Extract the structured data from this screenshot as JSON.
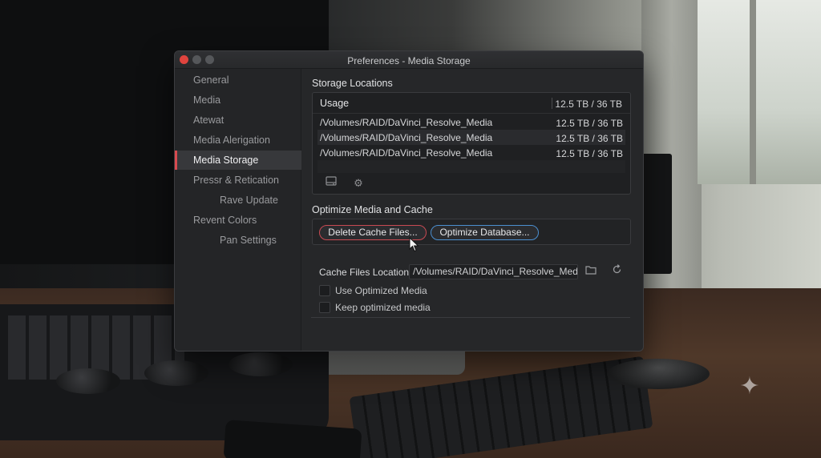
{
  "window": {
    "title": "Preferences - Media Storage"
  },
  "sidebar": {
    "items": [
      {
        "label": "General"
      },
      {
        "label": "Media"
      },
      {
        "label": "Atewat"
      },
      {
        "label": "Media Alerigation"
      },
      {
        "label": "Media Storage",
        "active": true
      },
      {
        "label": "Pressr & Retication"
      },
      {
        "label": "Rave Update",
        "sub": true
      },
      {
        "label": "Revent Colors"
      },
      {
        "label": "Pan Settings",
        "sub": true
      }
    ]
  },
  "storage": {
    "section_title": "Storage Locations",
    "header_label": "Usage",
    "header_value": "12.5 TB / 36 TB",
    "rows": [
      {
        "path": "/Volumes/RAID/DaVinci_Resolve_Media",
        "size": "12.5 TB / 36 TB"
      },
      {
        "path": "/Volumes/RAID/DaVinci_Resolve_Media",
        "size": "12.5 TB / 36 TB"
      },
      {
        "path": "/Volumes/RAID/DaVinci_Resolve_Media",
        "size": "12.5 TB / 36 TB"
      }
    ],
    "toolbar_icons": [
      "add-drive-icon",
      "gear-icon"
    ]
  },
  "optimize": {
    "section_title": "Optimize Media and Cache",
    "delete_label": "Delete Cache Files...",
    "optimize_label": "Optimize Database..."
  },
  "cache": {
    "label": "Cache Files Location",
    "path": "/Volumes/RAID/DaVinci_Resolve_Media",
    "icons": [
      "folder-icon",
      "reset-icon"
    ]
  },
  "options": {
    "use_optimized": {
      "label": "Use Optimized Media",
      "checked": false
    },
    "keep_optimized": {
      "label": "Keep optimized media",
      "checked": false
    }
  },
  "colors": {
    "active_accent": "#d84a4f",
    "delete_border": "#c94a53",
    "optimize_border": "#4b8fd0",
    "close_button": "#e0443e"
  }
}
